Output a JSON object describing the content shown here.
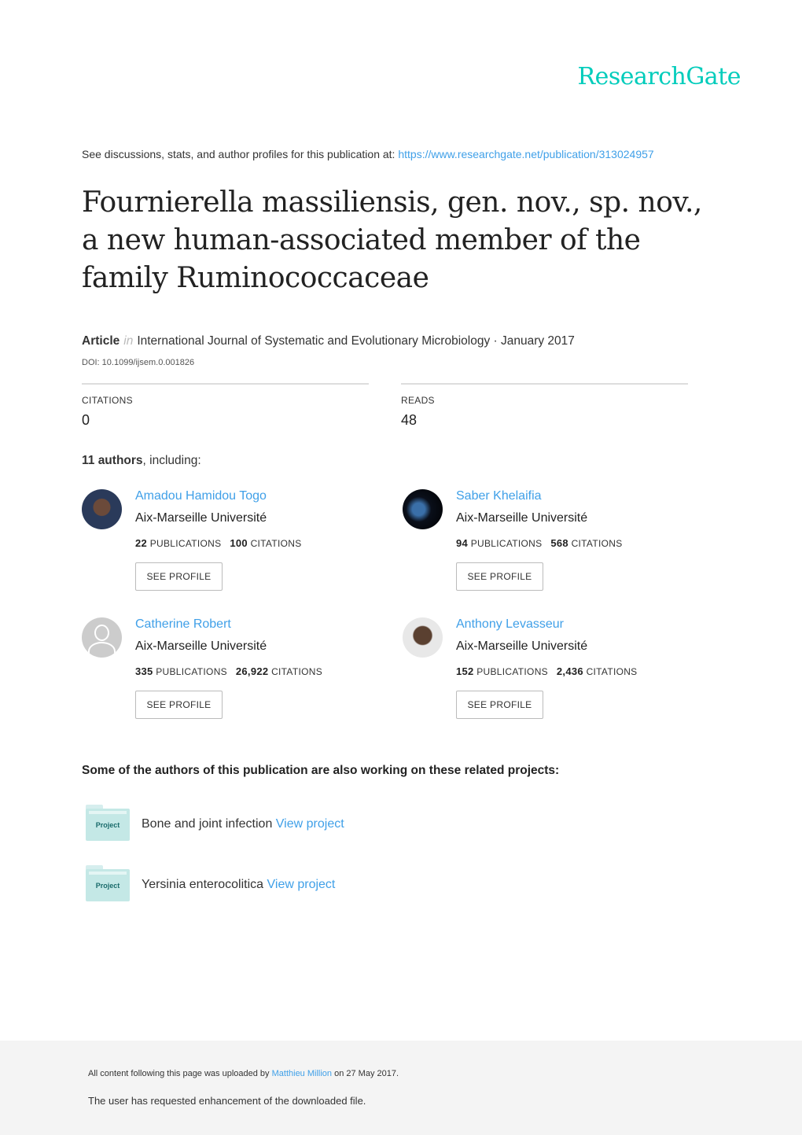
{
  "brand": {
    "logo": "ResearchGate",
    "accent": "#00ccbb",
    "link_color": "#40a0e8"
  },
  "header": {
    "discussion_text": "See discussions, stats, and author profiles for this publication at: ",
    "url": "https://www.researchgate.net/publication/313024957"
  },
  "publication": {
    "title": "Fournierella massiliensis, gen. nov., sp. nov., a new human-associated member of the family Ruminococcaceae",
    "type": "Article",
    "in": "in",
    "journal": "International Journal of Systematic and Evolutionary Microbiology · January 2017",
    "doi": "DOI: 10.1099/ijsem.0.001826"
  },
  "stats": {
    "citations_label": "CITATIONS",
    "citations": "0",
    "reads_label": "READS",
    "reads": "48"
  },
  "authors_header": {
    "count": "11 authors",
    "suffix": ", including:"
  },
  "authors": [
    {
      "name": "Amadou Hamidou Togo",
      "affiliation": "Aix-Marseille Université",
      "publications": "22",
      "citations": "100",
      "avatar": "photo"
    },
    {
      "name": "Saber Khelaifia",
      "affiliation": "Aix-Marseille Université",
      "publications": "94",
      "citations": "568",
      "avatar": "globe-photo"
    },
    {
      "name": "Catherine Robert",
      "affiliation": "Aix-Marseille Université",
      "publications": "335",
      "citations": "26,922",
      "avatar": "default-person-icon"
    },
    {
      "name": "Anthony Levasseur",
      "affiliation": "Aix-Marseille Université",
      "publications": "152",
      "citations": "2,436",
      "avatar": "photo"
    }
  ],
  "labels": {
    "publications": "PUBLICATIONS",
    "citations": "CITATIONS",
    "see_profile": "SEE PROFILE",
    "project_badge": "Project",
    "view_project": "View project"
  },
  "related": {
    "heading": "Some of the authors of this publication are also working on these related projects:",
    "projects": [
      {
        "name": "Bone and joint infection"
      },
      {
        "name": "Yersinia enterocolitica"
      }
    ]
  },
  "footer": {
    "uploaded_prefix": "All content following this page was uploaded by ",
    "uploader": "Matthieu Million",
    "uploaded_suffix": " on 27 May 2017.",
    "note": "The user has requested enhancement of the downloaded file."
  }
}
